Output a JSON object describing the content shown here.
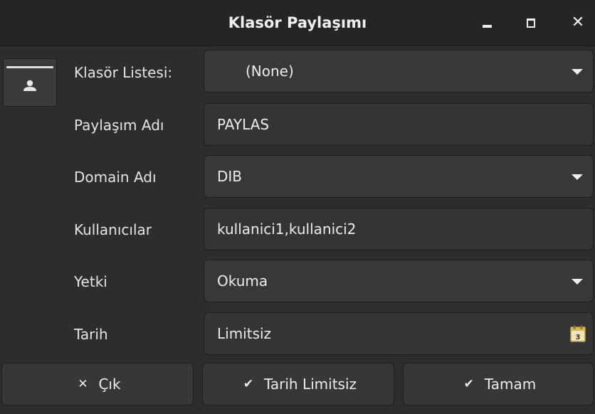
{
  "window": {
    "title": "Klasör Paylaşımı"
  },
  "form": {
    "folder_list": {
      "label": "Klasör Listesi:",
      "value": "(None)"
    },
    "share_name": {
      "label": "Paylaşım Adı",
      "value": "PAYLAS"
    },
    "domain_name": {
      "label": "Domain Adı",
      "value": "DIB"
    },
    "users": {
      "label": "Kullanıcılar",
      "value": "kullanici1,kullanici2"
    },
    "permission": {
      "label": "Yetki",
      "value": "Okuma"
    },
    "date": {
      "label": "Tarih",
      "value": "Limitsiz"
    }
  },
  "buttons": {
    "exit": "Çık",
    "no_limit": "Tarih Limitsiz",
    "ok": "Tamam"
  },
  "icons": {
    "side_tab": "person-icon",
    "exit": "close-icon",
    "no_limit": "check-icon",
    "ok": "check-icon",
    "date": "calendar-icon"
  }
}
